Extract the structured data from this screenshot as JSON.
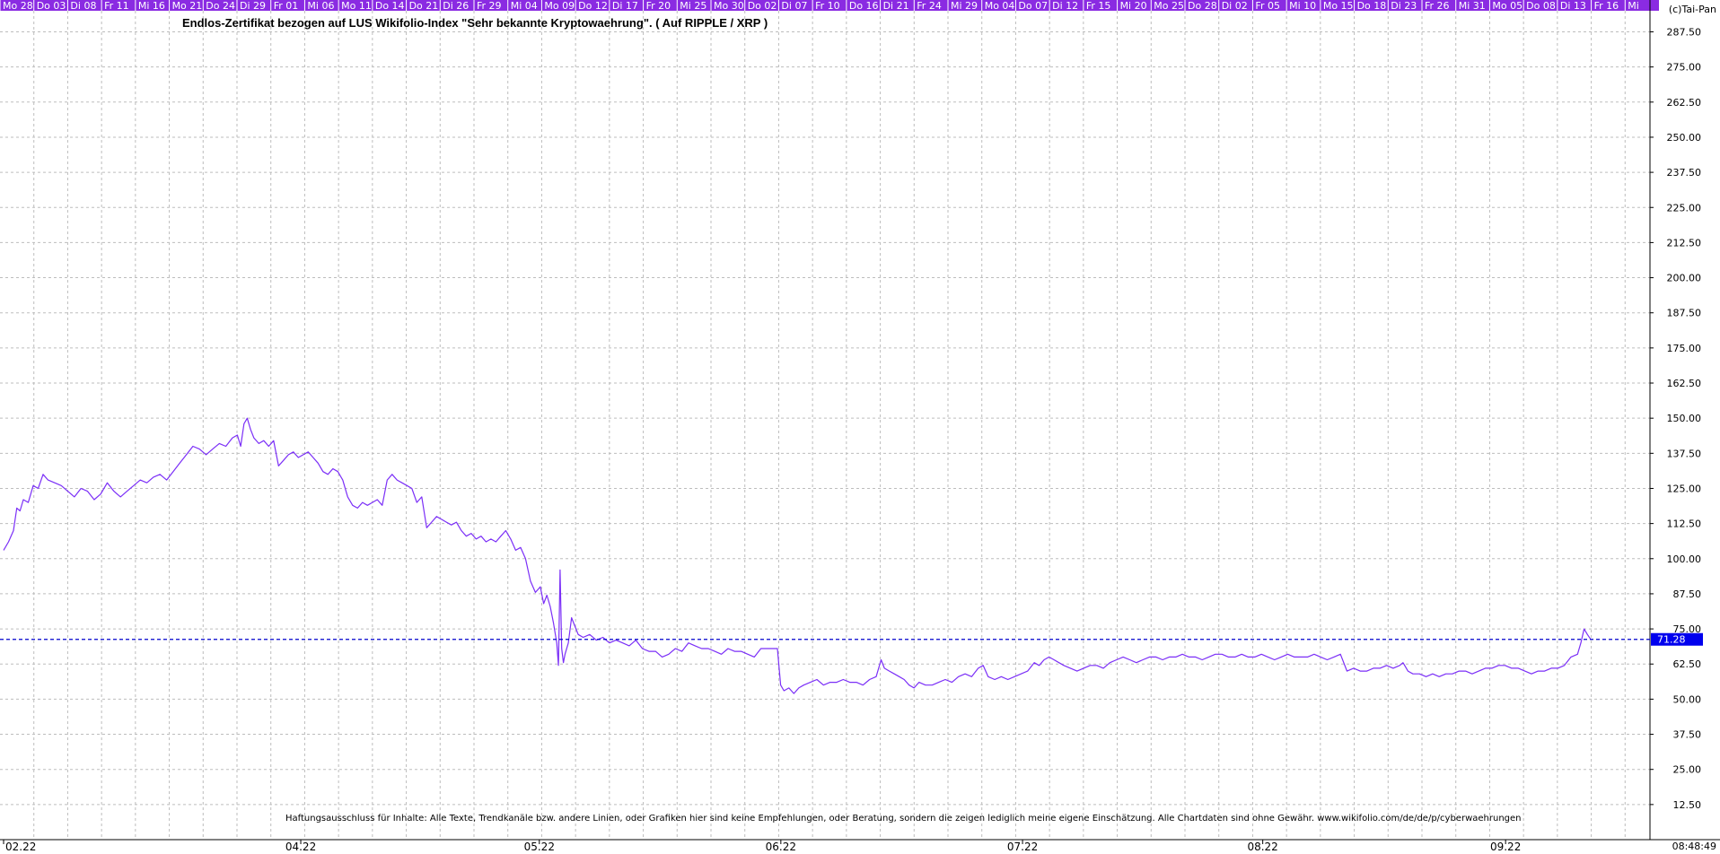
{
  "chart_data": {
    "type": "line",
    "title": "Endlos-Zertifikat bezogen auf LUS Wikifolio-Index \"Sehr bekannte Kryptowaehrung\". ( Auf RIPPLE / XRP )",
    "copyright": "(c)Tai-Pan",
    "disclaimer": "Haftungsausschluss für Inhalte: Alle Texte, Trendkanäle bzw. andere Linien, oder Grafiken hier sind keine Empfehlungen, oder Beratung, sondern die zeigen lediglich meine eigene Einschätzung. Alle Chartdaten sind ohne Gewähr. www.wikifolio.com/de/de/p/cyberwaehrungen",
    "timestamp": "08:48:49",
    "current_value_label": "71.28",
    "current_value": 71.28,
    "ylim": [
      0,
      295
    ],
    "y_ticks": [
      "12.50",
      "25.00",
      "37.50",
      "50.00",
      "62.50",
      "75.00",
      "87.50",
      "100.00",
      "112.50",
      "125.00",
      "137.50",
      "150.00",
      "162.50",
      "175.00",
      "187.50",
      "200.00",
      "212.50",
      "225.00",
      "237.50",
      "250.00",
      "262.50",
      "275.00",
      "287.50"
    ],
    "x_month_labels": [
      "02.22",
      "04.22",
      "05.22",
      "06.22",
      "07.22",
      "08.22",
      "09.22"
    ],
    "x_month_positions": [
      0,
      0.1805,
      0.3254,
      0.4721,
      0.6189,
      0.7648,
      0.9123
    ],
    "date_labels": [
      "Mo 28",
      "Do 03",
      "Di 08",
      "Fr 11",
      "Mi 16",
      "Mo 21",
      "Do 24",
      "Di 29",
      "Fr 01",
      "Mi 06",
      "Mo 11",
      "Do 14",
      "Do 21",
      "Di 26",
      "Fr 29",
      "Mi 04",
      "Mo 09",
      "Do 12",
      "Di 17",
      "Fr 20",
      "Mi 25",
      "Mo 30",
      "Do 02",
      "Di 07",
      "Fr 10",
      "Do 16",
      "Di 21",
      "Fr 24",
      "Mi 29",
      "Mo 04",
      "Do 07",
      "Di 12",
      "Fr 15",
      "Mi 20",
      "Mo 25",
      "Do 28",
      "Di 02",
      "Fr 05",
      "Mi 10",
      "Mo 15",
      "Do 18",
      "Di 23",
      "Fr 26",
      "Mi 31",
      "Mo 05",
      "Do 08",
      "Di 13",
      "Fr 16",
      "Mi"
    ],
    "grid": true,
    "colors": {
      "line": "#7b2ff7",
      "header_bar": "#8a2be2",
      "current_value_bg": "#0000ee",
      "current_value_line": "#0000cc",
      "grid": "#bdbdbd"
    },
    "x_range": [
      0,
      1
    ],
    "series": [
      {
        "points": [
          [
            0.0,
            103
          ],
          [
            0.003,
            106
          ],
          [
            0.006,
            110
          ],
          [
            0.008,
            118
          ],
          [
            0.01,
            117
          ],
          [
            0.012,
            121
          ],
          [
            0.015,
            120
          ],
          [
            0.018,
            126
          ],
          [
            0.021,
            125
          ],
          [
            0.024,
            130
          ],
          [
            0.027,
            128
          ],
          [
            0.031,
            127
          ],
          [
            0.035,
            126
          ],
          [
            0.039,
            124
          ],
          [
            0.043,
            122
          ],
          [
            0.047,
            125
          ],
          [
            0.051,
            124
          ],
          [
            0.055,
            121
          ],
          [
            0.059,
            123
          ],
          [
            0.063,
            127
          ],
          [
            0.067,
            124
          ],
          [
            0.071,
            122
          ],
          [
            0.075,
            124
          ],
          [
            0.079,
            126
          ],
          [
            0.083,
            128
          ],
          [
            0.087,
            127
          ],
          [
            0.091,
            129
          ],
          [
            0.095,
            130
          ],
          [
            0.099,
            128
          ],
          [
            0.103,
            131
          ],
          [
            0.107,
            134
          ],
          [
            0.111,
            137
          ],
          [
            0.115,
            140
          ],
          [
            0.119,
            139
          ],
          [
            0.123,
            137
          ],
          [
            0.127,
            139
          ],
          [
            0.131,
            141
          ],
          [
            0.135,
            140
          ],
          [
            0.139,
            143
          ],
          [
            0.142,
            144
          ],
          [
            0.144,
            140
          ],
          [
            0.146,
            148
          ],
          [
            0.148,
            150
          ],
          [
            0.15,
            146
          ],
          [
            0.152,
            143
          ],
          [
            0.155,
            141
          ],
          [
            0.158,
            142
          ],
          [
            0.161,
            140
          ],
          [
            0.164,
            142
          ],
          [
            0.167,
            133
          ],
          [
            0.17,
            135
          ],
          [
            0.173,
            137
          ],
          [
            0.176,
            138
          ],
          [
            0.179,
            136
          ],
          [
            0.182,
            137
          ],
          [
            0.185,
            138
          ],
          [
            0.188,
            136
          ],
          [
            0.191,
            134
          ],
          [
            0.194,
            131
          ],
          [
            0.197,
            130
          ],
          [
            0.2,
            132
          ],
          [
            0.203,
            131
          ],
          [
            0.206,
            128
          ],
          [
            0.209,
            122
          ],
          [
            0.212,
            119
          ],
          [
            0.215,
            118
          ],
          [
            0.218,
            120
          ],
          [
            0.221,
            119
          ],
          [
            0.224,
            120
          ],
          [
            0.227,
            121
          ],
          [
            0.23,
            119
          ],
          [
            0.233,
            128
          ],
          [
            0.236,
            130
          ],
          [
            0.239,
            128
          ],
          [
            0.242,
            127
          ],
          [
            0.245,
            126
          ],
          [
            0.248,
            125
          ],
          [
            0.251,
            120
          ],
          [
            0.254,
            122
          ],
          [
            0.257,
            111
          ],
          [
            0.26,
            113
          ],
          [
            0.263,
            115
          ],
          [
            0.266,
            114
          ],
          [
            0.269,
            113
          ],
          [
            0.272,
            112
          ],
          [
            0.275,
            113
          ],
          [
            0.278,
            110
          ],
          [
            0.281,
            108
          ],
          [
            0.284,
            109
          ],
          [
            0.287,
            107
          ],
          [
            0.29,
            108
          ],
          [
            0.293,
            106
          ],
          [
            0.296,
            107
          ],
          [
            0.299,
            106
          ],
          [
            0.302,
            108
          ],
          [
            0.305,
            110
          ],
          [
            0.308,
            107
          ],
          [
            0.311,
            103
          ],
          [
            0.314,
            104
          ],
          [
            0.317,
            100
          ],
          [
            0.32,
            92
          ],
          [
            0.323,
            88
          ],
          [
            0.326,
            90
          ],
          [
            0.328,
            84
          ],
          [
            0.33,
            87
          ],
          [
            0.332,
            83
          ],
          [
            0.334,
            77
          ],
          [
            0.336,
            70
          ],
          [
            0.337,
            62
          ],
          [
            0.338,
            96
          ],
          [
            0.339,
            68
          ],
          [
            0.34,
            63
          ],
          [
            0.341,
            66
          ],
          [
            0.343,
            70
          ],
          [
            0.345,
            79
          ],
          [
            0.347,
            76
          ],
          [
            0.349,
            73
          ],
          [
            0.352,
            72
          ],
          [
            0.356,
            73
          ],
          [
            0.36,
            71
          ],
          [
            0.364,
            72
          ],
          [
            0.368,
            70
          ],
          [
            0.372,
            71
          ],
          [
            0.376,
            70
          ],
          [
            0.38,
            69
          ],
          [
            0.384,
            71
          ],
          [
            0.388,
            68
          ],
          [
            0.392,
            67
          ],
          [
            0.396,
            67
          ],
          [
            0.4,
            65
          ],
          [
            0.404,
            66
          ],
          [
            0.408,
            68
          ],
          [
            0.412,
            67
          ],
          [
            0.416,
            70
          ],
          [
            0.42,
            69
          ],
          [
            0.424,
            68
          ],
          [
            0.428,
            68
          ],
          [
            0.432,
            67
          ],
          [
            0.436,
            66
          ],
          [
            0.44,
            68
          ],
          [
            0.444,
            67
          ],
          [
            0.448,
            67
          ],
          [
            0.452,
            66
          ],
          [
            0.456,
            65
          ],
          [
            0.46,
            68
          ],
          [
            0.47,
            68
          ],
          [
            0.472,
            55
          ],
          [
            0.474,
            53
          ],
          [
            0.477,
            54
          ],
          [
            0.48,
            52
          ],
          [
            0.483,
            54
          ],
          [
            0.486,
            55
          ],
          [
            0.49,
            56
          ],
          [
            0.494,
            57
          ],
          [
            0.498,
            55
          ],
          [
            0.502,
            56
          ],
          [
            0.506,
            56
          ],
          [
            0.51,
            57
          ],
          [
            0.514,
            56
          ],
          [
            0.518,
            56
          ],
          [
            0.522,
            55
          ],
          [
            0.526,
            57
          ],
          [
            0.53,
            58
          ],
          [
            0.533,
            64
          ],
          [
            0.535,
            61
          ],
          [
            0.538,
            60
          ],
          [
            0.541,
            59
          ],
          [
            0.544,
            58
          ],
          [
            0.547,
            57
          ],
          [
            0.55,
            55
          ],
          [
            0.553,
            54
          ],
          [
            0.556,
            56
          ],
          [
            0.56,
            55
          ],
          [
            0.564,
            55
          ],
          [
            0.568,
            56
          ],
          [
            0.572,
            57
          ],
          [
            0.576,
            56
          ],
          [
            0.58,
            58
          ],
          [
            0.584,
            59
          ],
          [
            0.588,
            58
          ],
          [
            0.592,
            61
          ],
          [
            0.595,
            62
          ],
          [
            0.598,
            58
          ],
          [
            0.602,
            57
          ],
          [
            0.606,
            58
          ],
          [
            0.61,
            57
          ],
          [
            0.614,
            58
          ],
          [
            0.618,
            59
          ],
          [
            0.622,
            60
          ],
          [
            0.626,
            63
          ],
          [
            0.629,
            62
          ],
          [
            0.632,
            64
          ],
          [
            0.635,
            65
          ],
          [
            0.638,
            64
          ],
          [
            0.641,
            63
          ],
          [
            0.644,
            62
          ],
          [
            0.648,
            61
          ],
          [
            0.652,
            60
          ],
          [
            0.656,
            61
          ],
          [
            0.66,
            62
          ],
          [
            0.664,
            62
          ],
          [
            0.668,
            61
          ],
          [
            0.672,
            63
          ],
          [
            0.676,
            64
          ],
          [
            0.68,
            65
          ],
          [
            0.684,
            64
          ],
          [
            0.688,
            63
          ],
          [
            0.692,
            64
          ],
          [
            0.696,
            65
          ],
          [
            0.7,
            65
          ],
          [
            0.704,
            64
          ],
          [
            0.708,
            65
          ],
          [
            0.712,
            65
          ],
          [
            0.716,
            66
          ],
          [
            0.72,
            65
          ],
          [
            0.724,
            65
          ],
          [
            0.728,
            64
          ],
          [
            0.732,
            65
          ],
          [
            0.736,
            66
          ],
          [
            0.74,
            66
          ],
          [
            0.744,
            65
          ],
          [
            0.748,
            65
          ],
          [
            0.752,
            66
          ],
          [
            0.756,
            65
          ],
          [
            0.76,
            65
          ],
          [
            0.764,
            66
          ],
          [
            0.768,
            65
          ],
          [
            0.772,
            64
          ],
          [
            0.776,
            65
          ],
          [
            0.78,
            66
          ],
          [
            0.784,
            65
          ],
          [
            0.788,
            65
          ],
          [
            0.792,
            65
          ],
          [
            0.796,
            66
          ],
          [
            0.8,
            65
          ],
          [
            0.804,
            64
          ],
          [
            0.808,
            65
          ],
          [
            0.812,
            66
          ],
          [
            0.816,
            60
          ],
          [
            0.82,
            61
          ],
          [
            0.824,
            60
          ],
          [
            0.828,
            60
          ],
          [
            0.832,
            61
          ],
          [
            0.836,
            61
          ],
          [
            0.84,
            62
          ],
          [
            0.844,
            61
          ],
          [
            0.848,
            62
          ],
          [
            0.85,
            63
          ],
          [
            0.853,
            60
          ],
          [
            0.856,
            59
          ],
          [
            0.86,
            59
          ],
          [
            0.864,
            58
          ],
          [
            0.868,
            59
          ],
          [
            0.872,
            58
          ],
          [
            0.876,
            59
          ],
          [
            0.88,
            59
          ],
          [
            0.884,
            60
          ],
          [
            0.888,
            60
          ],
          [
            0.892,
            59
          ],
          [
            0.896,
            60
          ],
          [
            0.9,
            61
          ],
          [
            0.904,
            61
          ],
          [
            0.908,
            62
          ],
          [
            0.912,
            62
          ],
          [
            0.916,
            61
          ],
          [
            0.92,
            61
          ],
          [
            0.924,
            60
          ],
          [
            0.928,
            59
          ],
          [
            0.932,
            60
          ],
          [
            0.936,
            60
          ],
          [
            0.94,
            61
          ],
          [
            0.944,
            61
          ],
          [
            0.948,
            62
          ],
          [
            0.952,
            65
          ],
          [
            0.956,
            66
          ],
          [
            0.958,
            70
          ],
          [
            0.96,
            75
          ],
          [
            0.962,
            73
          ],
          [
            0.964,
            71.28
          ]
        ]
      }
    ]
  }
}
